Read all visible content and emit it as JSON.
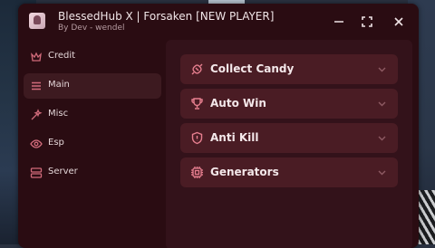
{
  "window": {
    "title": "BlessedHub X  | Forsaken [NEW PLAYER]",
    "subtitle": "By Dev - wendel"
  },
  "sidebar": {
    "items": [
      {
        "label": "Credit",
        "icon": "crown-icon",
        "active": false
      },
      {
        "label": "Main",
        "icon": "menu-icon",
        "active": true
      },
      {
        "label": "Misc",
        "icon": "sparkle-icon",
        "active": false
      },
      {
        "label": "Esp",
        "icon": "eye-icon",
        "active": false
      },
      {
        "label": "Server",
        "icon": "server-icon",
        "active": false
      }
    ]
  },
  "main": {
    "sections": [
      {
        "label": "Collect Candy",
        "icon": "candy-icon"
      },
      {
        "label": "Auto Win",
        "icon": "trophy-icon"
      },
      {
        "label": "Anti Kill",
        "icon": "shield-icon"
      },
      {
        "label": "Generators",
        "icon": "chip-icon"
      }
    ]
  },
  "colors": {
    "window_bg": "#2a0c12",
    "panel_bg": "#33121a",
    "row_bg": "#4a1c24",
    "accent": "#e77f8f"
  }
}
